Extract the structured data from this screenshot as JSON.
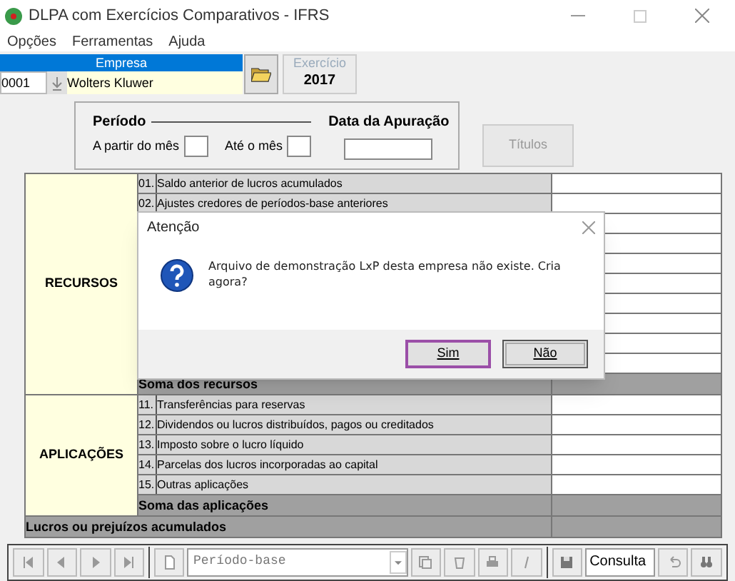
{
  "window": {
    "title": "DLPA com Exercícios Comparativos - IFRS"
  },
  "menu": [
    "Opções",
    "Ferramentas",
    "Ajuda"
  ],
  "empresa": {
    "label": "Empresa",
    "code": "0001",
    "name": "Wolters Kluwer"
  },
  "exercicio": {
    "label": "Exercício",
    "value": "2017"
  },
  "periodo": {
    "title": "Período",
    "from_label": "A partir do mês",
    "to_label": "Até o mês",
    "data_label": "Data da Apuração"
  },
  "titulos_button": "Títulos",
  "sections": [
    {
      "label": "RECURSOS",
      "rows": [
        {
          "code": "01.",
          "text": "Saldo anterior de lucros acumulados"
        },
        {
          "code": "02.",
          "text": "Ajustes credores de períodos-base anteriores"
        }
      ],
      "total": "Soma dos recursos"
    },
    {
      "label": "APLICAÇÕES",
      "rows": [
        {
          "code": "11.",
          "text": "Transferências para reservas"
        },
        {
          "code": "12.",
          "text": "Dividendos ou lucros distribuídos, pagos ou creditados"
        },
        {
          "code": "13.",
          "text": "Imposto sobre o lucro líquido"
        },
        {
          "code": "14.",
          "text": "Parcelas dos lucros incorporadas ao capital"
        },
        {
          "code": "15.",
          "text": "Outras aplicações"
        }
      ],
      "total": "Soma das aplicações"
    }
  ],
  "grand_total": "Lucros ou prejuízos acumulados",
  "toolbar": {
    "period_combo": "Período-base",
    "mode": "Consulta"
  },
  "dialog": {
    "title": "Atenção",
    "message": "Arquivo de demonstração LxP desta empresa não existe. Cria agora?",
    "buttons": [
      {
        "label": "Sim",
        "selected": true
      },
      {
        "label": "Não",
        "selected": false
      }
    ]
  }
}
